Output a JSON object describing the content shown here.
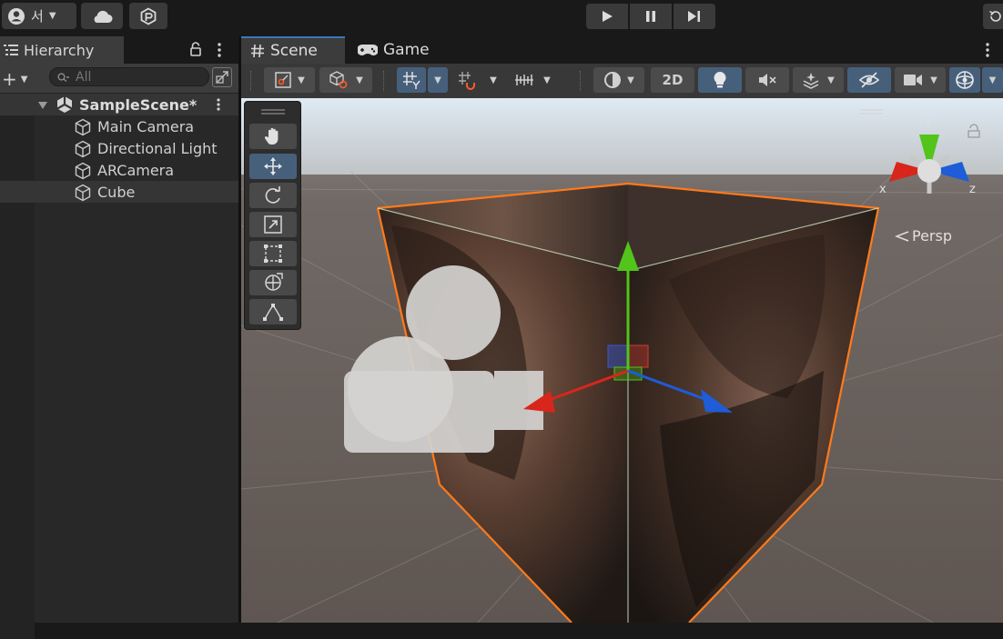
{
  "toolbar": {
    "account_initial": "서",
    "play_controls": [
      "play",
      "pause",
      "step"
    ]
  },
  "hierarchy": {
    "tab_label": "Hierarchy",
    "search_placeholder": "All",
    "scene": {
      "name": "SampleScene*"
    },
    "items": [
      {
        "label": "Main Camera"
      },
      {
        "label": "Directional Light"
      },
      {
        "label": "ARCamera"
      },
      {
        "label": "Cube"
      }
    ]
  },
  "scene_view": {
    "tabs": [
      {
        "label": "Scene",
        "icon": "hash-icon",
        "active": true
      },
      {
        "label": "Game",
        "icon": "gamepad-icon",
        "active": false
      }
    ],
    "toolbar": {
      "mode_2d_label": "2D"
    },
    "gizmo": {
      "axes": [
        "x",
        "y",
        "z"
      ],
      "projection_label": "Persp"
    },
    "tools": [
      "hand",
      "move",
      "rotate",
      "scale",
      "rect",
      "transform",
      "custom"
    ],
    "active_tool": "move"
  },
  "colors": {
    "accent_blue": "#3a79bb",
    "selection_outline": "#ff7a1c",
    "axis_x": "#d8261c",
    "axis_y": "#52c41a",
    "axis_z": "#1e5cd8",
    "ground": "#6e6560",
    "sky": "#e4eef6"
  }
}
